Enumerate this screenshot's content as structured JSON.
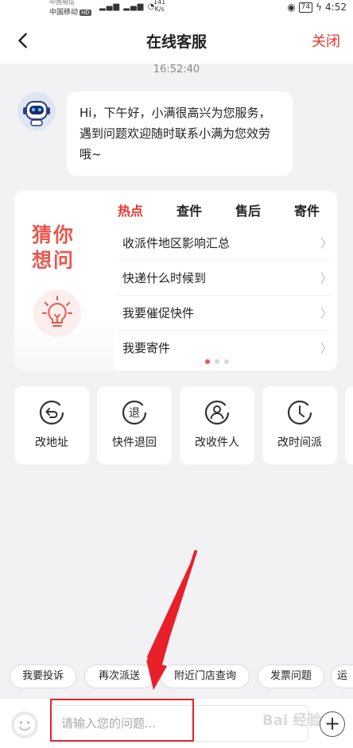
{
  "status_bar": {
    "carrier_top": "中国电信",
    "carrier_bottom": "中国移动",
    "hd_badge": "HD",
    "net_speed_value": "141",
    "net_speed_unit": "K/s",
    "battery": "74",
    "time": "4:52"
  },
  "header": {
    "back_icon": "chevron-left-icon",
    "title": "在线客服",
    "close_label": "关闭"
  },
  "chat": {
    "timestamp": "16:52:40",
    "bot_avatar": "robot-avatar-icon",
    "bot_message": "Hi，下午好，小满很高兴为您服务，遇到问题欢迎随时联系小满为您效劳哦~"
  },
  "guess": {
    "title": "猜你想问",
    "tabs": [
      {
        "label": "热点",
        "active": true
      },
      {
        "label": "查件",
        "active": false
      },
      {
        "label": "售后",
        "active": false
      },
      {
        "label": "寄件",
        "active": false
      }
    ],
    "questions": [
      "收派件地区影响汇总",
      "快递什么时候到",
      "我要催促快件",
      "我要寄件"
    ],
    "page_indicator": {
      "pages": 3,
      "current": 1
    }
  },
  "quick_actions": [
    {
      "label": "改地址",
      "icon": "undo-circle-icon"
    },
    {
      "label": "快件退回",
      "icon": "return-circle-icon",
      "glyph": "退"
    },
    {
      "label": "改收件人",
      "icon": "person-circle-icon"
    },
    {
      "label": "改时间派",
      "icon": "clock-circle-icon"
    }
  ],
  "chips": [
    "我要投诉",
    "再次派送",
    "附近门店查询",
    "发票问题",
    "运"
  ],
  "input": {
    "placeholder": "请输入您的问题...",
    "emoji_icon": "emoji-icon",
    "plus_icon": "plus-icon"
  },
  "watermark": "Bai  经验",
  "colors": {
    "accent": "#e8342a",
    "guess_title": "#e8584f",
    "background": "#f2f2f4"
  }
}
